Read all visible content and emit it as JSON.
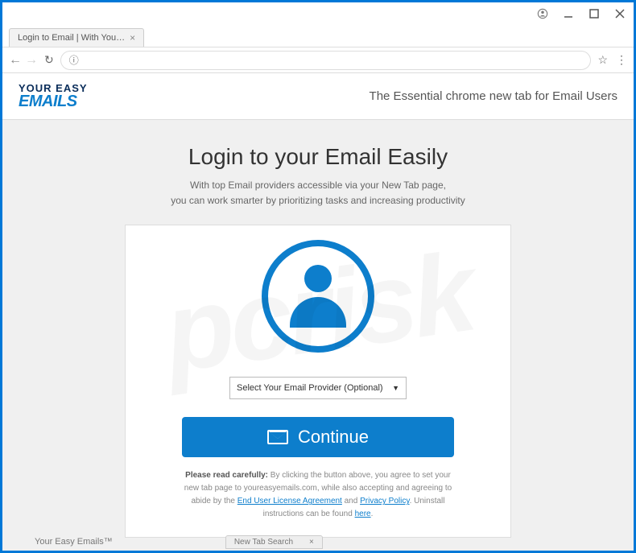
{
  "window": {
    "tab_title": "Login to Email | With You…"
  },
  "header": {
    "logo_line1": "YOUR EASY",
    "logo_line2": "EMAILS",
    "tagline": "The Essential chrome new tab for Email Users"
  },
  "main": {
    "heading": "Login to your Email Easily",
    "sub1": "With top Email providers accessible via your New Tab page,",
    "sub2": "you can work smarter by prioritizing tasks and increasing productivity",
    "select_placeholder": "Select Your Email Provider (Optional)",
    "continue_label": "Continue",
    "disclaimer_strong": "Please read carefully:",
    "disclaimer_1": " By clicking the button above, you agree to set your new tab page to youreasyemails.com, while also accepting and agreeing to abide by the ",
    "eula": "End User License Agreement",
    "and": " and ",
    "privacy": "Privacy Policy",
    "disclaimer_2": ". Uninstall instructions can be found ",
    "here": "here",
    "period": "."
  },
  "footer": {
    "brand": "Your Easy Emails™",
    "tab_label": "New Tab Search"
  }
}
